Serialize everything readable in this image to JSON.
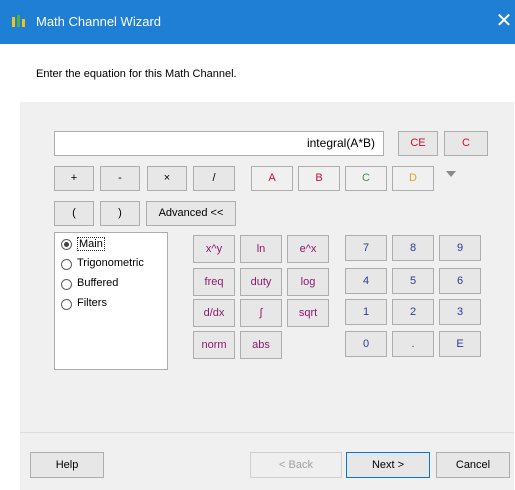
{
  "window": {
    "title": "Math Channel Wizard",
    "close_glyph": "✕"
  },
  "instruction": "Enter the equation for this Math Channel.",
  "equation": {
    "value": "integral(A*B)"
  },
  "clear": {
    "ce": "CE",
    "c": "C"
  },
  "operators": [
    "+",
    "-",
    "×",
    "/"
  ],
  "channels": [
    {
      "label": "A",
      "color": "#c8102e"
    },
    {
      "label": "B",
      "color": "#c8102e"
    },
    {
      "label": "C",
      "color": "#3a9a3a"
    },
    {
      "label": "D",
      "color": "#e0a020"
    }
  ],
  "parens": {
    "open": "(",
    "close": ")"
  },
  "advanced_button": "Advanced <<",
  "categories": [
    {
      "label": "Main",
      "selected": true
    },
    {
      "label": "Trigonometric",
      "selected": false
    },
    {
      "label": "Buffered",
      "selected": false
    },
    {
      "label": "Filters",
      "selected": false
    }
  ],
  "functions": [
    "x^y",
    "ln",
    "e^x",
    "freq",
    "duty",
    "log",
    "d/dx",
    "∫",
    "sqrt",
    "norm",
    "abs"
  ],
  "keypad": [
    "7",
    "8",
    "9",
    "4",
    "5",
    "6",
    "1",
    "2",
    "3",
    "0",
    ".",
    "E"
  ],
  "footer": {
    "help": "Help",
    "back": "< Back",
    "next": "Next >",
    "cancel": "Cancel"
  },
  "colors": {
    "titlebar": "#1e7fd4",
    "function_text": "#8a1a6e",
    "keypad_text": "#2a3a9a",
    "ce_text": "#c8102e"
  }
}
